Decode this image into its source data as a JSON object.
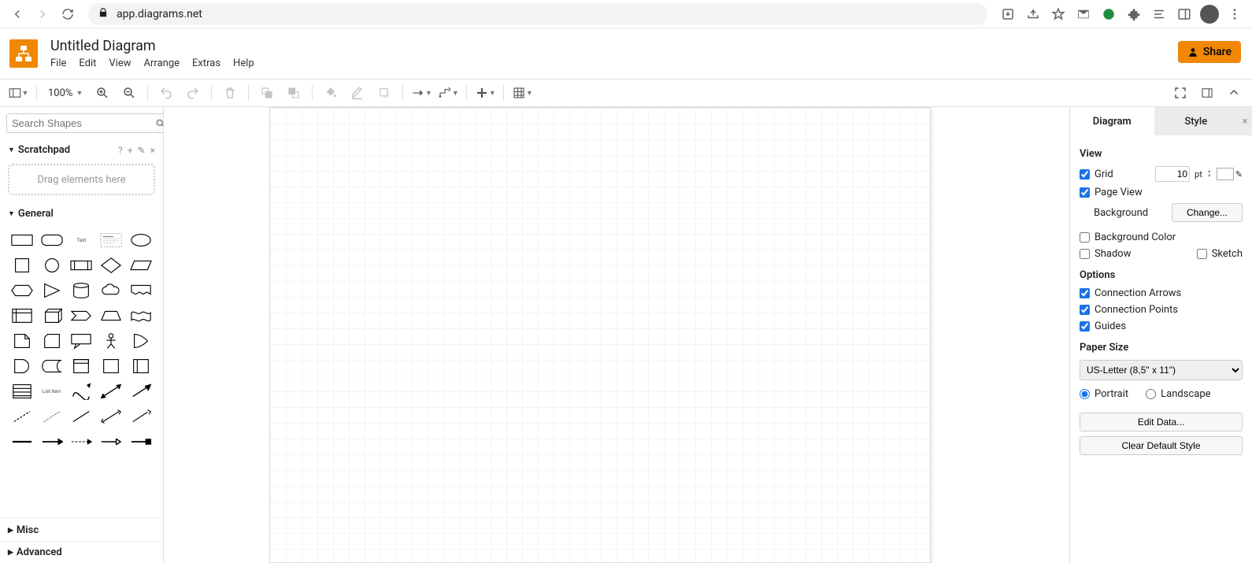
{
  "browser": {
    "url": "app.diagrams.net"
  },
  "header": {
    "title": "Untitled Diagram",
    "menu": [
      "File",
      "Edit",
      "View",
      "Arrange",
      "Extras",
      "Help"
    ],
    "share_label": "Share"
  },
  "toolbar": {
    "zoom": "100%"
  },
  "left": {
    "search_placeholder": "Search Shapes",
    "scratchpad_label": "Scratchpad",
    "scratchpad_hint": "Drag elements here",
    "general_label": "General",
    "misc_label": "Misc",
    "advanced_label": "Advanced"
  },
  "right": {
    "tabs": {
      "diagram": "Diagram",
      "style": "Style"
    },
    "view_label": "View",
    "grid_label": "Grid",
    "grid_value": "10",
    "grid_unit": "pt",
    "pageview_label": "Page View",
    "background_label": "Background",
    "change_label": "Change...",
    "bgcolor_label": "Background Color",
    "shadow_label": "Shadow",
    "sketch_label": "Sketch",
    "options_label": "Options",
    "conn_arrows_label": "Connection Arrows",
    "conn_points_label": "Connection Points",
    "guides_label": "Guides",
    "paper_label": "Paper Size",
    "paper_value": "US-Letter (8,5\" x 11\")",
    "portrait_label": "Portrait",
    "landscape_label": "Landscape",
    "edit_data_label": "Edit Data...",
    "clear_style_label": "Clear Default Style"
  }
}
